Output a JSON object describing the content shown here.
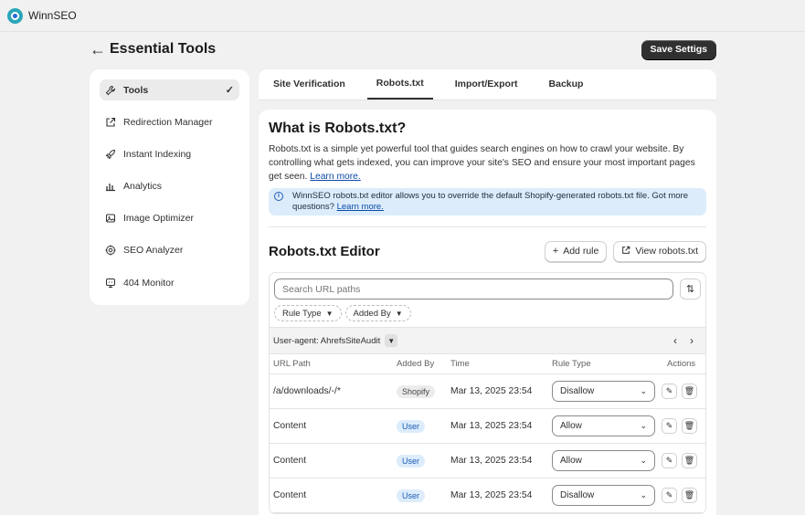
{
  "app": {
    "name": "WinnSEO"
  },
  "header": {
    "title": "Essential Tools",
    "save_label": "Save Settigs"
  },
  "sidebar": {
    "items": [
      {
        "label": "Tools",
        "icon": "wrench-icon",
        "active": true
      },
      {
        "label": "Redirection Manager",
        "icon": "external-link-icon"
      },
      {
        "label": "Instant Indexing",
        "icon": "rocket-icon"
      },
      {
        "label": "Analytics",
        "icon": "bar-chart-icon"
      },
      {
        "label": "Image Optimizer",
        "icon": "image-icon"
      },
      {
        "label": "SEO Analyzer",
        "icon": "target-icon"
      },
      {
        "label": "404 Monitor",
        "icon": "monitor-icon"
      }
    ]
  },
  "tabs": [
    {
      "label": "Site Verification"
    },
    {
      "label": "Robots.txt",
      "active": true
    },
    {
      "label": "Import/Export"
    },
    {
      "label": "Backup"
    }
  ],
  "intro": {
    "title": "What is Robots.txt?",
    "text": "Robots.txt is a simple yet powerful tool that guides search engines on how to crawl your website. By controlling what gets indexed, you can improve your site's SEO and ensure your most important pages get seen.",
    "link": "Learn more."
  },
  "banner": {
    "text": "WinnSEO robots.txt editor allows you to override the default Shopify-generated robots.txt file. Got more questions?",
    "link": "Learn more."
  },
  "editor": {
    "title": "Robots.txt Editor",
    "add_rule": "Add rule",
    "view_robots": "View robots.txt",
    "search_placeholder": "Search URL paths",
    "filters": [
      "Rule Type",
      "Added By"
    ],
    "user_agent": "User-agent: AhrefsSiteAudit",
    "columns": [
      "URL Path",
      "Added By",
      "Time",
      "Rule Type",
      "Actions"
    ],
    "rows": [
      {
        "path": "/a/downloads/-/*",
        "added_by": "Shopify",
        "time": "Mar 13, 2025 23:54",
        "rule": "Disallow"
      },
      {
        "path": "Content",
        "added_by": "User",
        "time": "Mar 13, 2025 23:54",
        "rule": "Allow"
      },
      {
        "path": "Content",
        "added_by": "User",
        "time": "Mar 13, 2025 23:54",
        "rule": "Allow"
      },
      {
        "path": "Content",
        "added_by": "User",
        "time": "Mar 13, 2025 23:54",
        "rule": "Disallow"
      }
    ]
  }
}
